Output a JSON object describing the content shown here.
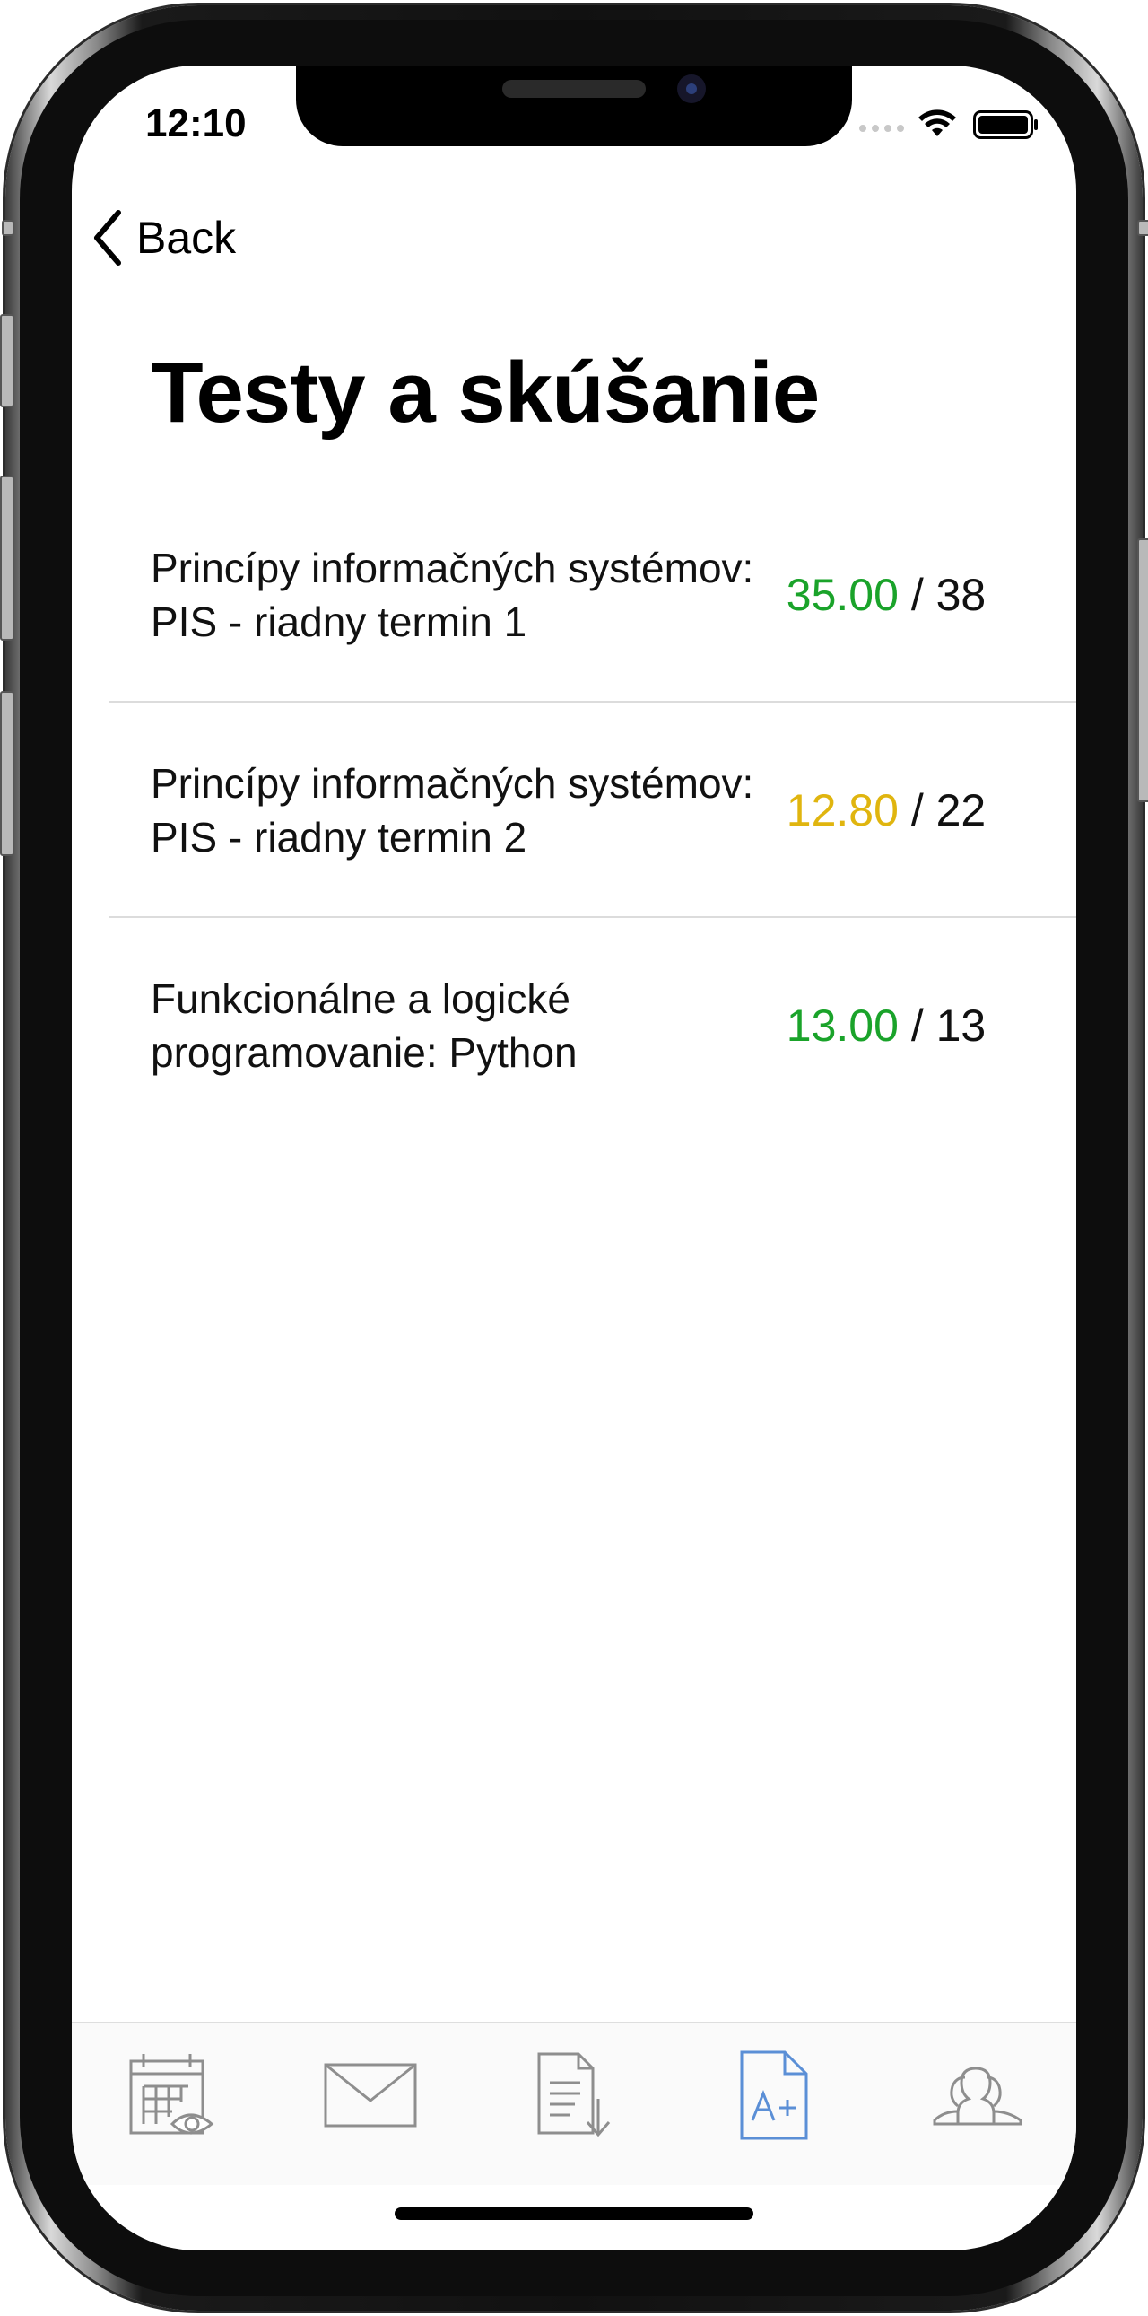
{
  "status_bar": {
    "time": "12:10"
  },
  "nav": {
    "back_label": "Back"
  },
  "page": {
    "title": "Testy a skúšanie"
  },
  "tests": [
    {
      "name": "Princípy informačných systémov: PIS - riadny termin 1",
      "score": "35.00",
      "max": "/ 38",
      "score_color": "#1aa32a"
    },
    {
      "name": "Princípy informačných systémov: PIS - riadny termin 2",
      "score": "12.80",
      "max": "/ 22",
      "score_color": "#e0b50f"
    },
    {
      "name": "Funkcionálne a logické programovanie: Python",
      "score": "13.00",
      "max": "/ 13",
      "score_color": "#1aa32a"
    }
  ],
  "tab_bar": {
    "tabs": [
      {
        "icon": "calendar-eye-icon",
        "active": false
      },
      {
        "icon": "envelope-icon",
        "active": false
      },
      {
        "icon": "document-download-icon",
        "active": false
      },
      {
        "icon": "grade-document-icon",
        "active": true
      },
      {
        "icon": "people-icon",
        "active": false
      }
    ],
    "active_color": "#5b8fd6",
    "inactive_color": "#8e8e8e"
  }
}
